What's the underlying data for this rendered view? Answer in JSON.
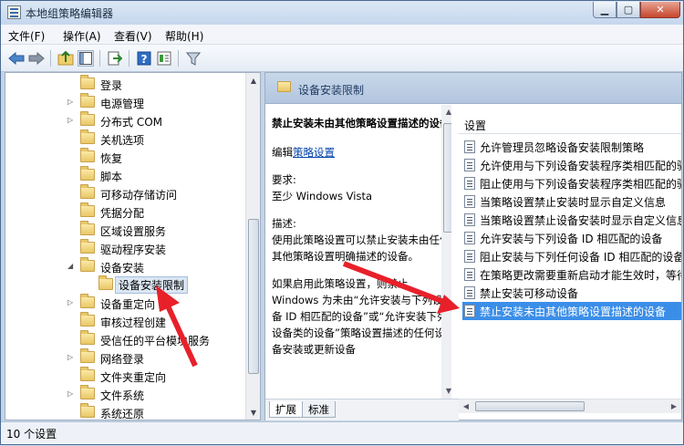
{
  "window": {
    "title": "本地组策略编辑器"
  },
  "menu": [
    "文件(F)",
    "操作(A)",
    "查看(V)",
    "帮助(H)"
  ],
  "tree": {
    "items": [
      {
        "label": "登录",
        "expandable": false
      },
      {
        "label": "电源管理",
        "expandable": true
      },
      {
        "label": "分布式 COM",
        "expandable": true
      },
      {
        "label": "关机选项",
        "expandable": false
      },
      {
        "label": "恢复",
        "expandable": false
      },
      {
        "label": "脚本",
        "expandable": false
      },
      {
        "label": "可移动存储访问",
        "expandable": false
      },
      {
        "label": "凭据分配",
        "expandable": false
      },
      {
        "label": "区域设置服务",
        "expandable": false
      },
      {
        "label": "驱动程序安装",
        "expandable": false
      },
      {
        "label": "设备安装",
        "expandable": true,
        "expanded": true
      },
      {
        "label": "设备安装限制",
        "selected": true,
        "child": true
      },
      {
        "label": "设备重定向",
        "expandable": true
      },
      {
        "label": "审核过程创建",
        "expandable": false
      },
      {
        "label": "受信任的平台模块服务",
        "expandable": false
      },
      {
        "label": "网络登录",
        "expandable": true
      },
      {
        "label": "文件夹重定向",
        "expandable": false
      },
      {
        "label": "文件系统",
        "expandable": true
      },
      {
        "label": "系统还原",
        "expandable": false
      }
    ]
  },
  "right": {
    "header": "设备安装限制",
    "description": {
      "title": "禁止安装未由其他策略设置描述的设备",
      "edit_prefix": "编辑",
      "edit_link": "策略设置",
      "req_label": "要求:",
      "req_value": "至少 Windows Vista",
      "desc_label": "描述:",
      "desc_text": "使用此策略设置可以禁止安装未由任何其他策略设置明确描述的设备。",
      "desc_text2": "如果启用此策略设置，则禁止 Windows 为未由“允许安装与下列设备 ID 相匹配的设备”或“允许安装下列设备类的设备”策略设置描述的任何设备安装或更新设备"
    },
    "list_header": "设置",
    "settings": [
      "允许管理员忽略设备安装限制策略",
      "允许使用与下列设备安装程序类相匹配的驱动程序安装设备",
      "阻止使用与下列设备安装程序类相匹配的驱动程序安装设备",
      "当策略设置禁止安装时显示自定义信息",
      "当策略设置禁止设备安装时显示自定义信息标题",
      "允许安装与下列设备 ID 相匹配的设备",
      "阻止安装与下列任何设备 ID 相匹配的设备",
      "在策略更改需要重新启动才能生效时，等待重新启动",
      "禁止安装可移动设备",
      "禁止安装未由其他策略设置描述的设备"
    ],
    "selected_index": 9,
    "tabs": [
      "扩展",
      "标准"
    ]
  },
  "status": "10 个设置",
  "colors": {
    "selection": "#3b8ee8",
    "arrow": "#e8202a"
  }
}
